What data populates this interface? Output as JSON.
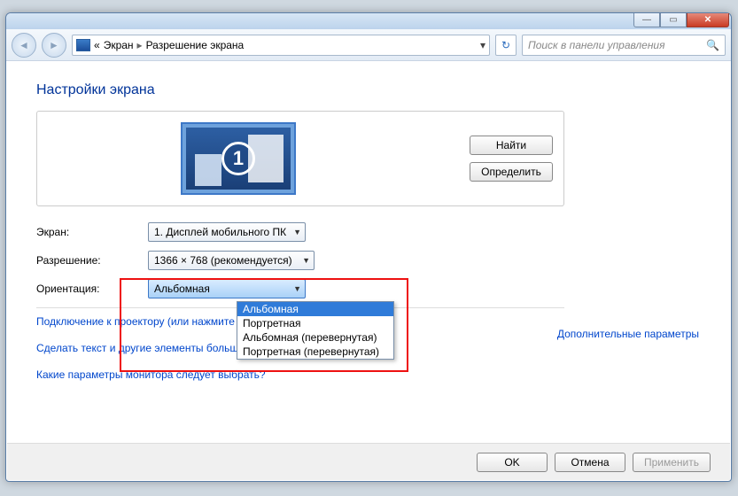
{
  "titlebar": {
    "min_glyph": "—",
    "max_glyph": "▭",
    "close_glyph": "✕"
  },
  "toolbar": {
    "back_glyph": "◄",
    "fwd_glyph": "►",
    "bc_prefix": "«",
    "bc_item1": "Экран",
    "bc_sep": "▸",
    "bc_item2": "Разрешение экрана",
    "bc_drop": "▾",
    "refresh_glyph": "↻",
    "search_placeholder": "Поиск в панели управления",
    "search_glyph": "🔍"
  },
  "content": {
    "heading": "Настройки экрана",
    "monitor_number": "1",
    "btn_find": "Найти",
    "btn_detect": "Определить",
    "label_screen": "Экран:",
    "value_screen": "1. Дисплей мобильного ПК",
    "label_resolution": "Разрешение:",
    "value_resolution": "1366 × 768 (рекомендуется)",
    "label_orientation": "Ориентация:",
    "value_orientation": "Альбомная",
    "orientation_options": {
      "o0": "Альбомная",
      "o1": "Портретная",
      "o2": "Альбомная (перевернутая)",
      "o3": "Портретная (перевернутая)"
    },
    "link_advanced": "Дополнительные параметры",
    "link_projector": "Подключение к проектору (или нажмите клавишу  и коснитесь P)",
    "link_textsize": "Сделать текст и другие элементы больше или меньше",
    "link_monitorpick": "Какие параметры монитора следует выбрать?"
  },
  "buttons": {
    "ok": "OK",
    "cancel": "Отмена",
    "apply": "Применить"
  }
}
